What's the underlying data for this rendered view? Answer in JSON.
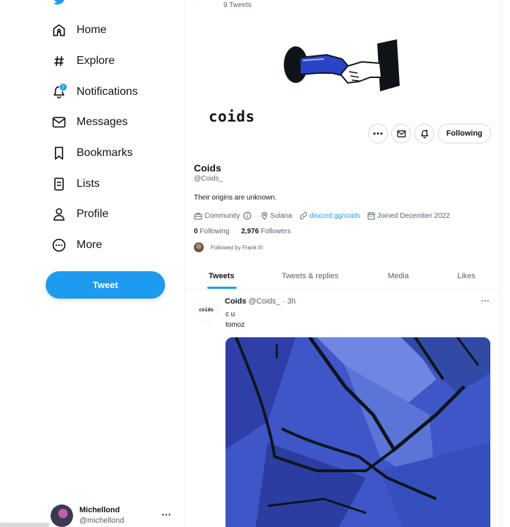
{
  "sidebar": {
    "items": [
      {
        "label": "Home",
        "icon": "home-icon"
      },
      {
        "label": "Explore",
        "icon": "hashtag-icon"
      },
      {
        "label": "Notifications",
        "icon": "bell-icon",
        "badge": "2"
      },
      {
        "label": "Messages",
        "icon": "envelope-icon"
      },
      {
        "label": "Bookmarks",
        "icon": "bookmark-icon"
      },
      {
        "label": "Lists",
        "icon": "list-icon"
      },
      {
        "label": "Profile",
        "icon": "person-icon"
      },
      {
        "label": "More",
        "icon": "more-circle-icon"
      }
    ],
    "tweet_button": "Tweet",
    "account": {
      "name": "Michellond",
      "handle": "@michellond",
      "more": "···"
    }
  },
  "header": {
    "tweet_count": "9 Tweets"
  },
  "profile": {
    "avatar_text": "coids",
    "name": "Coids",
    "handle": "@Coids_",
    "bio": "Their origins are unknown.",
    "community": "Community",
    "location": "Solana",
    "link": "discord.gg/coids",
    "joined": "Joined December 2022",
    "following_count": "0",
    "following_label": "Following",
    "followers_count": "2,976",
    "followers_label": "Followers",
    "followed_by": "Followed by Frank III",
    "follow_state_button": "Following"
  },
  "tabs": [
    {
      "label": "Tweets",
      "active": true
    },
    {
      "label": "Tweets & replies",
      "active": false
    },
    {
      "label": "Media",
      "active": false
    },
    {
      "label": "Likes",
      "active": false
    }
  ],
  "tweet": {
    "avatar_text": "coids",
    "name": "Coids",
    "meta": "@Coids_ · 3h",
    "line1": "c u",
    "line2": "tomoz",
    "more": "···"
  },
  "colors": {
    "accent": "#1d9bf0",
    "text": "#0f1419",
    "muted": "#536471",
    "media_blue": "#3f56c9"
  }
}
